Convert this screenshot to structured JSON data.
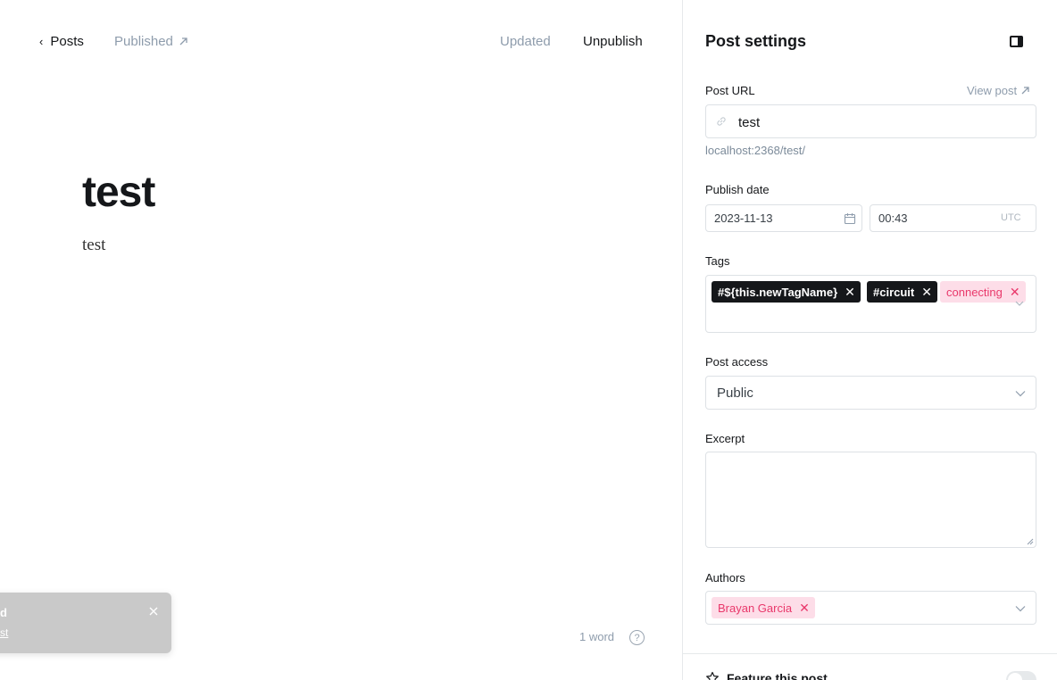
{
  "topbar": {
    "back_label": "Posts",
    "status_label": "Published",
    "updated_label": "Updated",
    "unpublish_label": "Unpublish"
  },
  "post": {
    "title": "test",
    "body": "test"
  },
  "toast": {
    "title": "d",
    "link": "st"
  },
  "footer": {
    "word_count": "1 word",
    "help_label": "?"
  },
  "settings": {
    "title": "Post settings",
    "url_label": "Post URL",
    "view_post_label": "View post",
    "url_value": "test",
    "url_hint": "localhost:2368/test/",
    "publish_date_label": "Publish date",
    "date_value": "2023-11-13",
    "time_value": "00:43",
    "timezone": "UTC",
    "tags_label": "Tags",
    "tags": [
      {
        "name": "#${this.newTagName}",
        "style": "internal"
      },
      {
        "name": "#circuit",
        "style": "internal"
      },
      {
        "name": "connecting",
        "style": "new"
      }
    ],
    "access_label": "Post access",
    "access_value": "Public",
    "excerpt_label": "Excerpt",
    "excerpt_value": "",
    "authors_label": "Authors",
    "authors": [
      "Brayan Garcia"
    ],
    "feature_label": "Feature this post",
    "feature_enabled": false
  },
  "colors": {
    "text": "#15171a",
    "muted": "#8e9cac",
    "tag_dark": "#15171a",
    "tag_pink_bg": "#fddde8",
    "tag_pink_text": "#e9386b"
  }
}
